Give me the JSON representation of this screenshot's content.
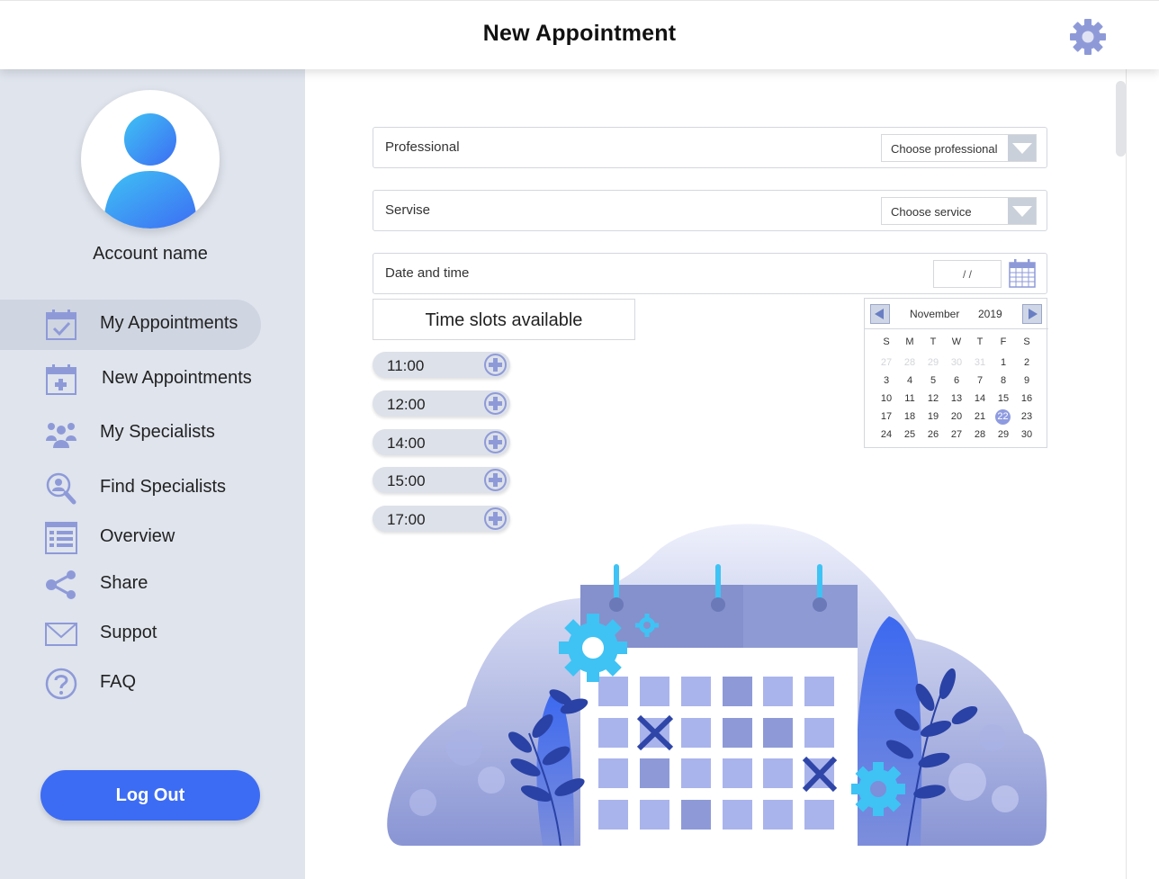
{
  "header": {
    "title": "New Appointment",
    "settings_icon": "gear-icon"
  },
  "sidebar": {
    "account_name": "Account name",
    "items": [
      {
        "label": "My Appointments",
        "icon": "calendar-check-icon",
        "active": true
      },
      {
        "label": "New Appointments",
        "icon": "calendar-plus-icon",
        "active": false
      },
      {
        "label": "My Specialists",
        "icon": "people-group-icon",
        "active": false
      },
      {
        "label": "Find Specialists",
        "icon": "search-person-icon",
        "active": false
      },
      {
        "label": "Overview",
        "icon": "list-icon",
        "active": false
      },
      {
        "label": "Share",
        "icon": "share-icon",
        "active": false
      },
      {
        "label": "Suppot",
        "icon": "envelope-icon",
        "active": false
      },
      {
        "label": "FAQ",
        "icon": "question-icon",
        "active": false
      }
    ],
    "logout_label": "Log Out"
  },
  "form": {
    "professional": {
      "label": "Professional",
      "value": "Choose professional"
    },
    "service": {
      "label": "Servise",
      "value": "Choose service"
    },
    "datetime": {
      "label": "Date and time",
      "value": "/ /"
    }
  },
  "time_slots": {
    "title": "Time slots available",
    "slots": [
      "11:00",
      "12:00",
      "14:00",
      "15:00",
      "17:00"
    ]
  },
  "calendar": {
    "month": "November",
    "year": "2019",
    "weekdays": [
      "S",
      "M",
      "T",
      "W",
      "T",
      "F",
      "S"
    ],
    "selected_day": "22",
    "weeks": [
      [
        "27",
        "28",
        "29",
        "30",
        "31",
        "1",
        "2"
      ],
      [
        "3",
        "4",
        "5",
        "6",
        "7",
        "8",
        "9"
      ],
      [
        "10",
        "11",
        "12",
        "13",
        "14",
        "15",
        "16"
      ],
      [
        "17",
        "18",
        "19",
        "20",
        "21",
        "22",
        "23"
      ],
      [
        "24",
        "25",
        "26",
        "27",
        "28",
        "29",
        "30"
      ]
    ],
    "muted_first_week_count": 5
  },
  "colors": {
    "accent": "#3d6cf4",
    "icon": "#8e9ad8",
    "sidebar_bg": "#dfe4ed",
    "illustration_main": "#8b97d6"
  }
}
